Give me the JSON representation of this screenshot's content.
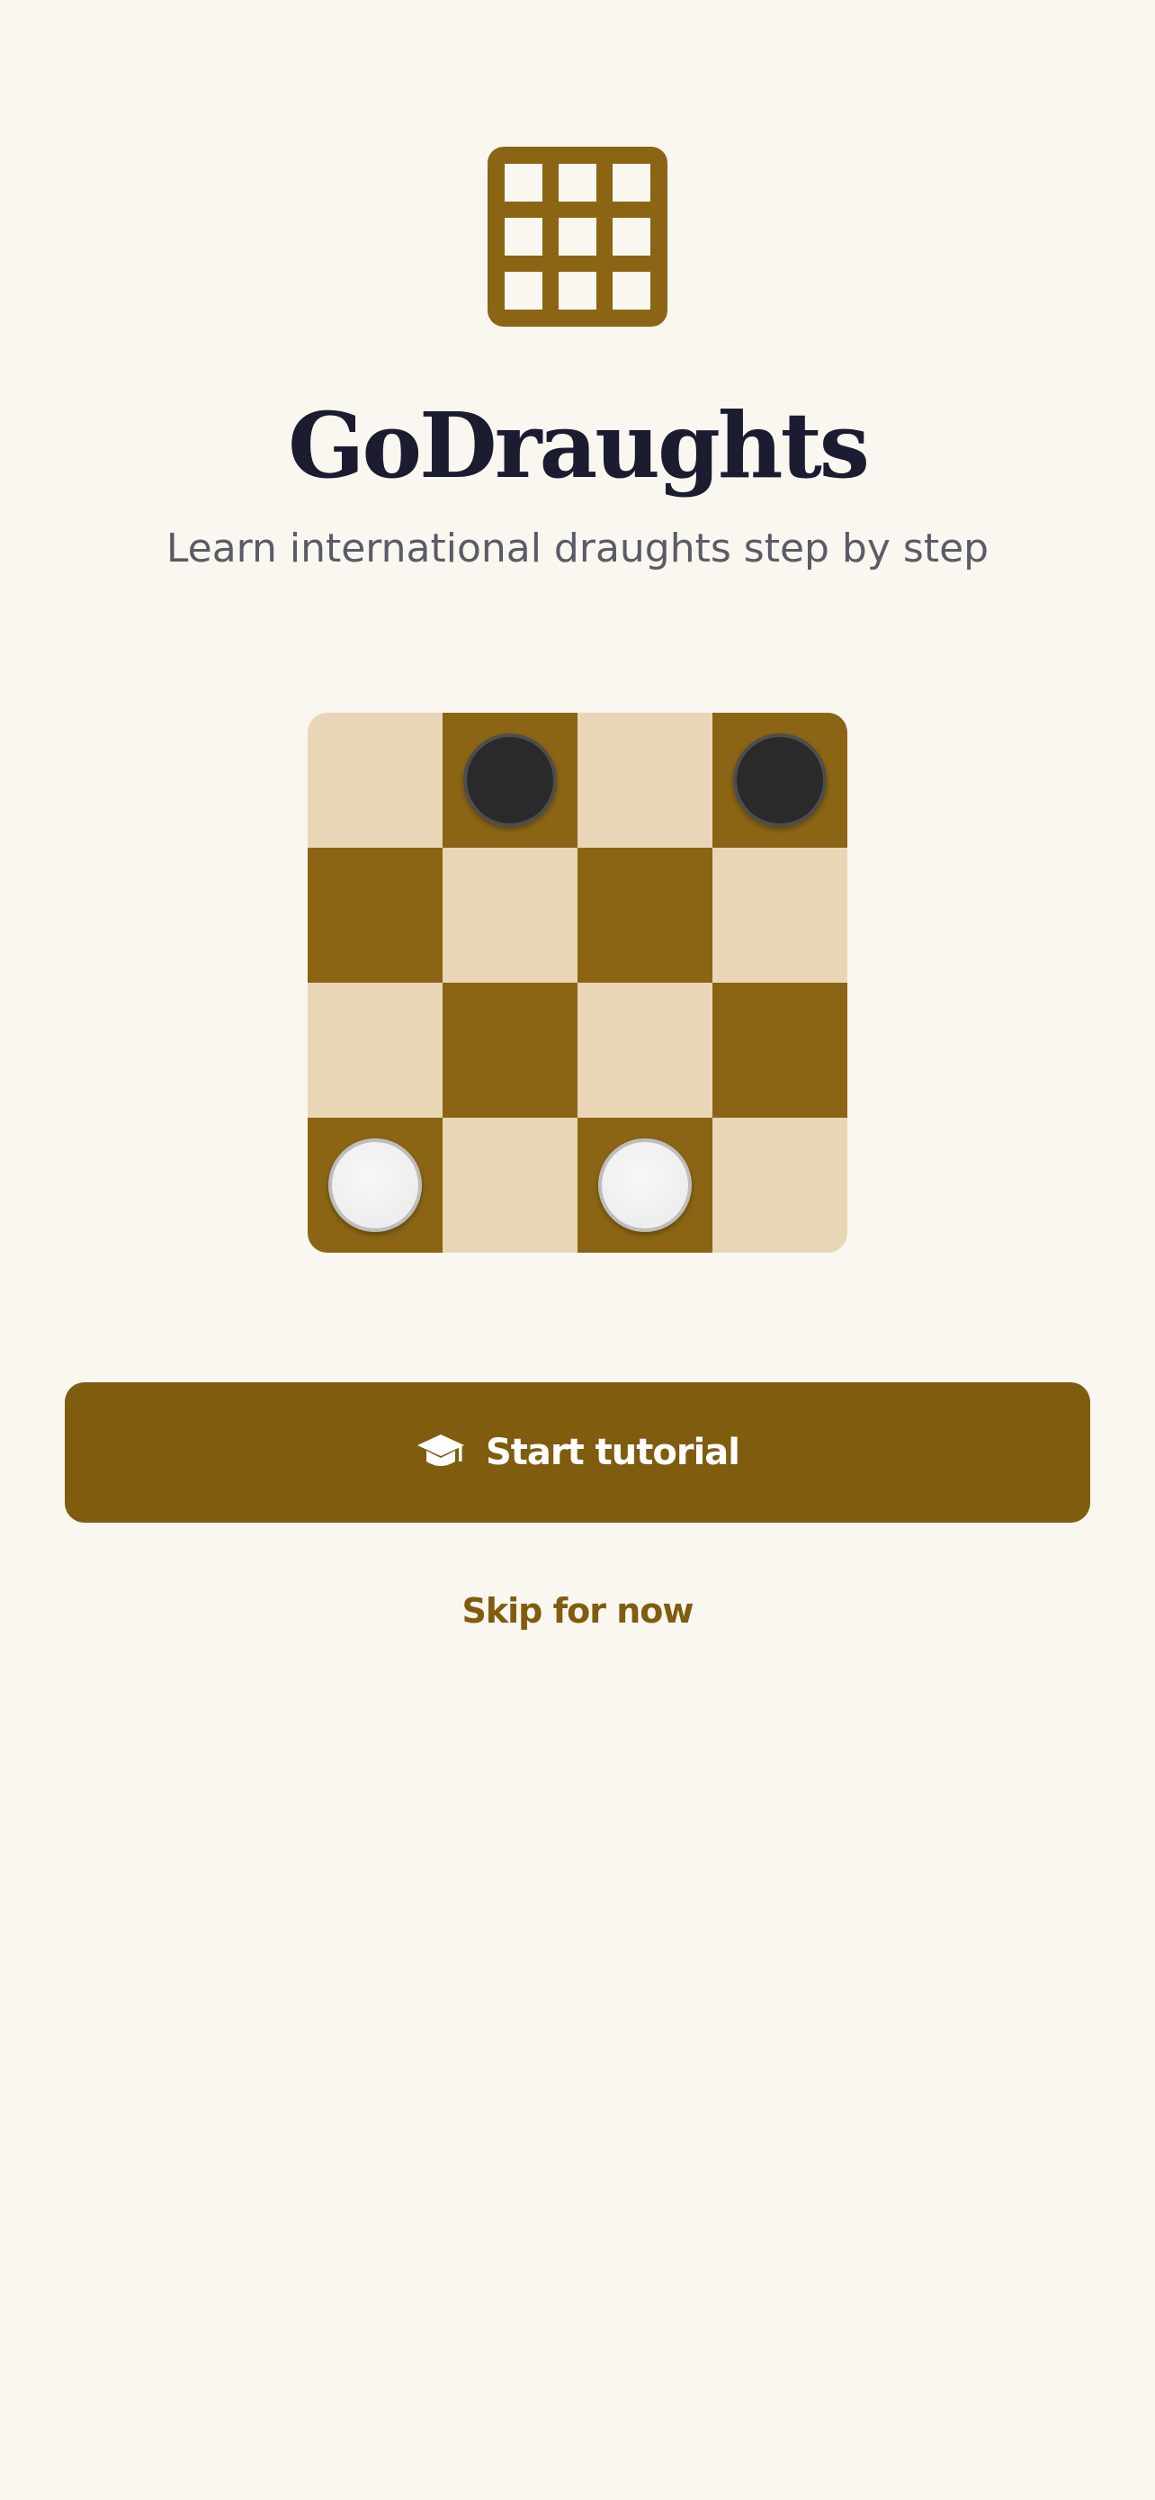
{
  "app": {
    "title": "GoDraughts",
    "subtitle": "Learn international draughts step by step"
  },
  "logo": {
    "icon": "grid-icon",
    "color": "#8b6513"
  },
  "board": {
    "rows": 4,
    "cols": 4,
    "light_color": "#e9d6b6",
    "dark_color": "#8b6513",
    "pieces": [
      {
        "row": 0,
        "col": 1,
        "color": "black"
      },
      {
        "row": 0,
        "col": 3,
        "color": "black"
      },
      {
        "row": 3,
        "col": 0,
        "color": "white"
      },
      {
        "row": 3,
        "col": 2,
        "color": "white"
      }
    ]
  },
  "actions": {
    "start_label": "Start tutorial",
    "start_icon": "graduation-cap-icon",
    "skip_label": "Skip for now"
  },
  "colors": {
    "background": "#faf7f1",
    "accent": "#805c0f",
    "title": "#1c1c30",
    "subtitle": "#5b5b66"
  }
}
